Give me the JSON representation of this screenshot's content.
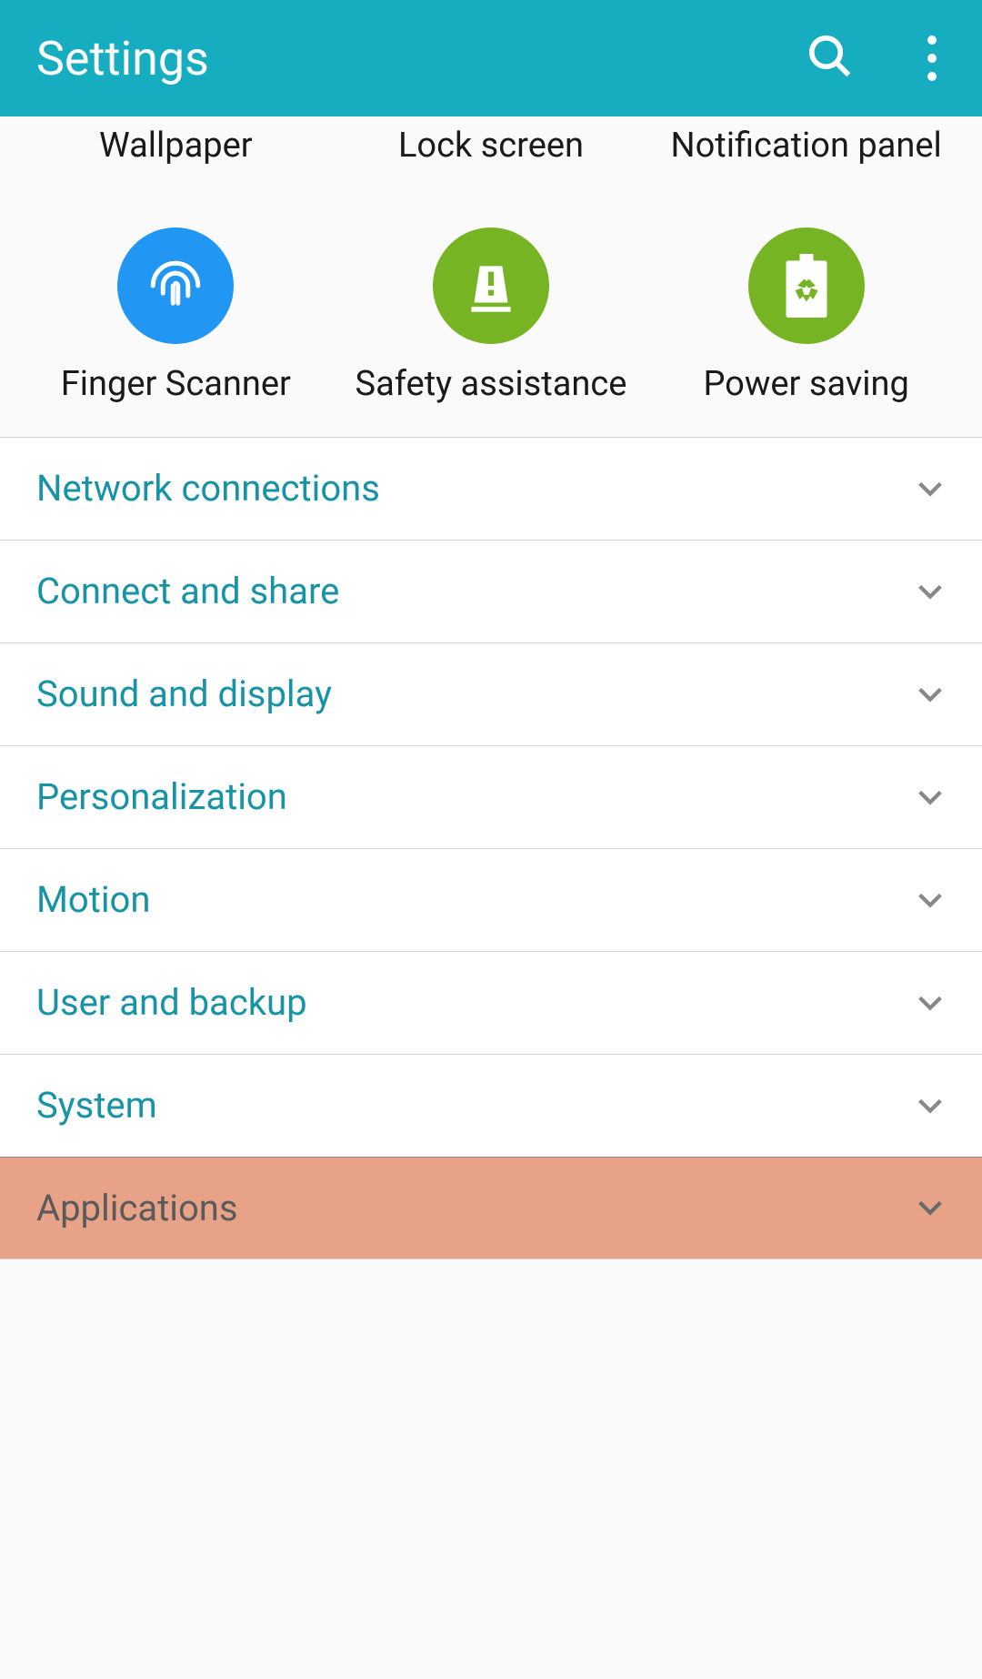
{
  "header": {
    "title": "Settings"
  },
  "quickTop": [
    {
      "label": "Wallpaper"
    },
    {
      "label": "Lock screen"
    },
    {
      "label": "Notification panel"
    }
  ],
  "quickBottom": [
    {
      "label": "Finger Scanner"
    },
    {
      "label": "Safety assistance"
    },
    {
      "label": "Power saving"
    }
  ],
  "categories": [
    {
      "label": "Network connections",
      "highlighted": false
    },
    {
      "label": "Connect and share",
      "highlighted": false
    },
    {
      "label": "Sound and display",
      "highlighted": false
    },
    {
      "label": "Personalization",
      "highlighted": false
    },
    {
      "label": "Motion",
      "highlighted": false
    },
    {
      "label": "User and backup",
      "highlighted": false
    },
    {
      "label": "System",
      "highlighted": false
    },
    {
      "label": "Applications",
      "highlighted": true
    }
  ]
}
